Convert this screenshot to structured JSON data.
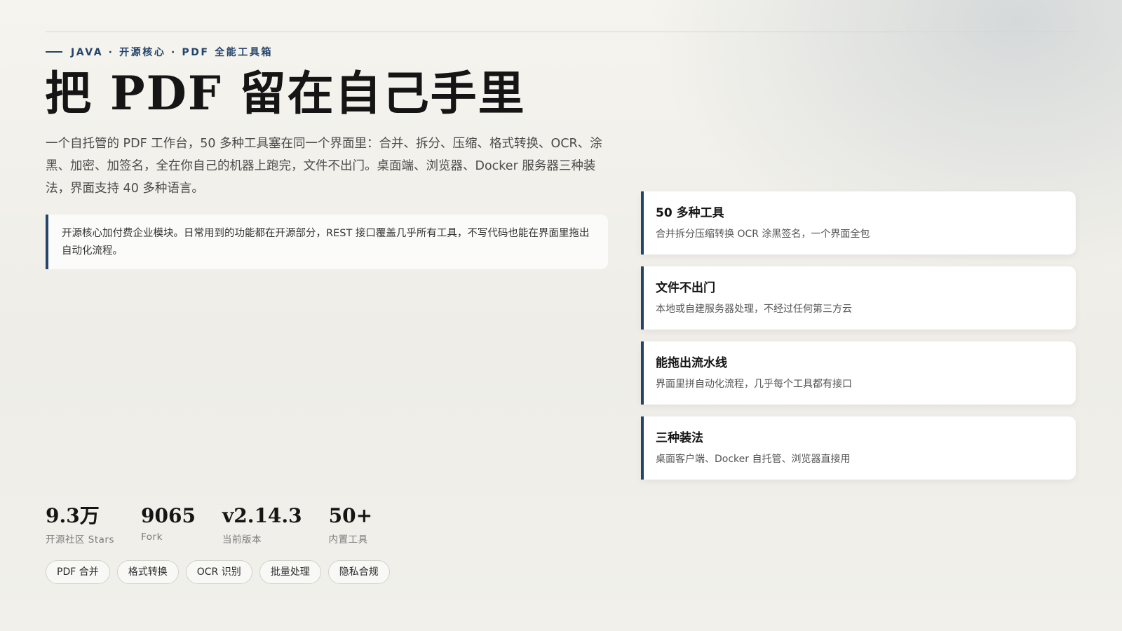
{
  "header": {
    "eyebrow": "JAVA · 开源核心 · PDF 全能工具箱",
    "title": "把 PDF 留在自己手里",
    "lead": "一个自托管的 PDF 工作台，50 多种工具塞在同一个界面里：合并、拆分、压缩、格式转换、OCR、涂黑、加密、加签名，全在你自己的机器上跑完，文件不出门。桌面端、浏览器、Docker 服务器三种装法，界面支持 40 多种语言。"
  },
  "note": "开源核心加付费企业模块。日常用到的功能都在开源部分，REST 接口覆盖几乎所有工具，不写代码也能在界面里拖出自动化流程。",
  "features": [
    {
      "title": "50 多种工具",
      "desc": "合并拆分压缩转换 OCR 涂黑签名，一个界面全包"
    },
    {
      "title": "文件不出门",
      "desc": "本地或自建服务器处理，不经过任何第三方云"
    },
    {
      "title": "能拖出流水线",
      "desc": "界面里拼自动化流程，几乎每个工具都有接口"
    },
    {
      "title": "三种装法",
      "desc": "桌面客户端、Docker 自托管、浏览器直接用"
    }
  ],
  "stats": [
    {
      "value": "9.3万",
      "label": "开源社区 Stars"
    },
    {
      "value": "9065",
      "label": "Fork"
    },
    {
      "value": "v2.14.3",
      "label": "当前版本"
    },
    {
      "value": "50+",
      "label": "内置工具"
    }
  ],
  "tags": [
    "PDF 合并",
    "格式转换",
    "OCR 识别",
    "批量处理",
    "隐私合规"
  ],
  "colors": {
    "accent": "#23446b",
    "background": "#f2f1eb",
    "card": "#ffffff"
  }
}
